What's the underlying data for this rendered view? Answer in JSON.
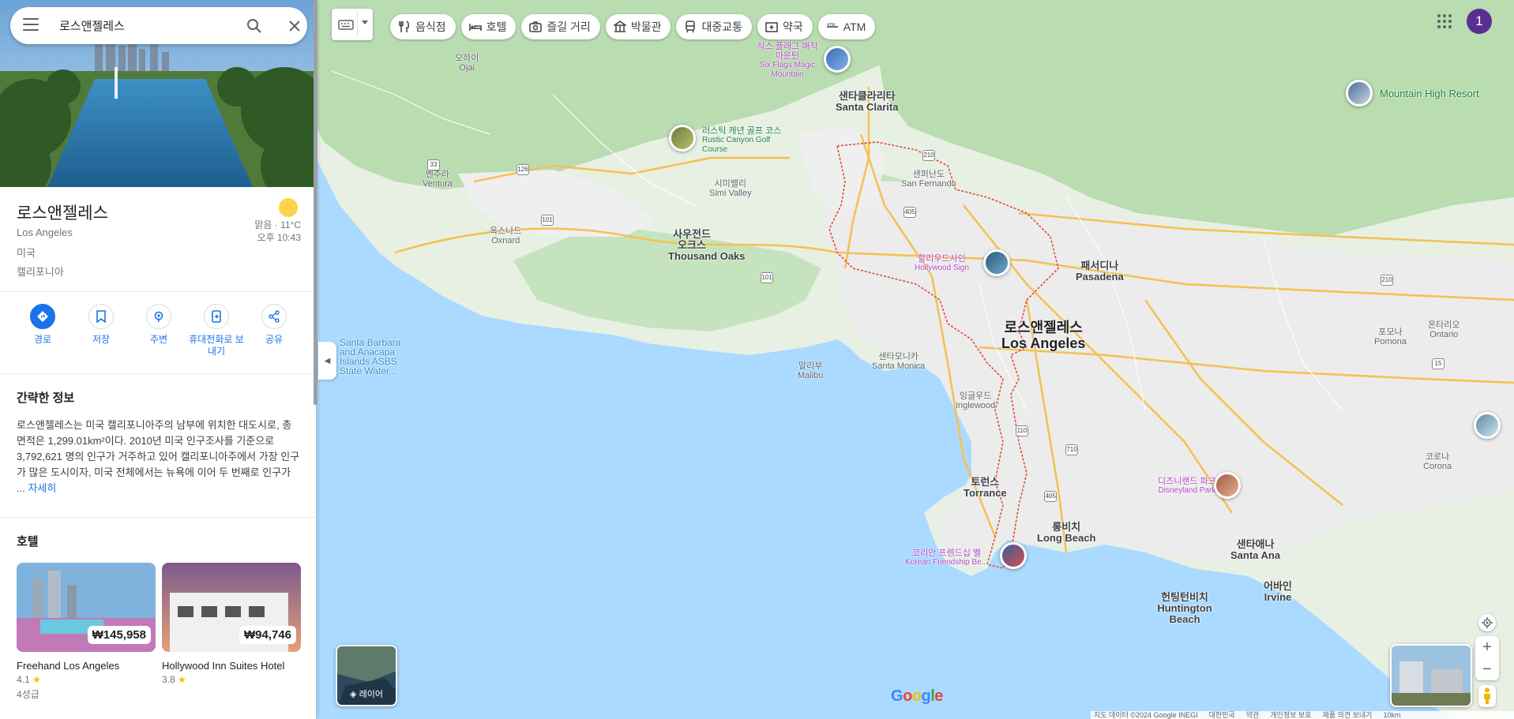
{
  "search": {
    "value": "로스앤젤레스"
  },
  "place": {
    "title": "로스앤젤레스",
    "name_en": "Los Angeles",
    "country": "미국",
    "state": "캘리포니아",
    "weather": "맑음 · 11°C",
    "time": "오후 10:43"
  },
  "actions": [
    {
      "label": "경로",
      "icon": "directions-icon"
    },
    {
      "label": "저장",
      "icon": "bookmark-icon"
    },
    {
      "label": "주변",
      "icon": "nearby-icon"
    },
    {
      "label": "휴대전화로 보내기",
      "icon": "send-to-phone-icon"
    },
    {
      "label": "공유",
      "icon": "share-icon"
    }
  ],
  "about": {
    "heading": "간략한 정보",
    "text": "로스앤젤레스는 미국 캘리포니아주의 남부에 위치한 대도시로, 총면적은 1,299.01km²이다. 2010년 미국 인구조사를 기준으로 3,792,621 명의 인구가 거주하고 있어 캘리포니아주에서 가장 인구가 많은 도시이자, 미국 전체에서는 뉴욕에 이어 두 번째로 인구가 ...",
    "more": "자세히"
  },
  "hotels": {
    "heading": "호텔",
    "items": [
      {
        "price": "₩145,958",
        "name": "Freehand Los Angeles",
        "rating": "4.1",
        "class": "4성급"
      },
      {
        "price": "₩94,746",
        "name": "Hollywood Inn Suites Hotel",
        "rating": "3.8",
        "class": ""
      }
    ]
  },
  "chips": [
    {
      "label": "음식점",
      "icon": "restaurant-icon"
    },
    {
      "label": "호텔",
      "icon": "hotel-icon"
    },
    {
      "label": "즐길 거리",
      "icon": "camera-icon"
    },
    {
      "label": "박물관",
      "icon": "museum-icon"
    },
    {
      "label": "대중교통",
      "icon": "transit-icon"
    },
    {
      "label": "약국",
      "icon": "pharmacy-icon"
    },
    {
      "label": "ATM",
      "icon": "atm-icon"
    }
  ],
  "account": {
    "initial": "1"
  },
  "layers_label": "레이어",
  "footer": [
    "지도 데이터 ©2024 Google INEGI",
    "대한민국",
    "약관",
    "개인정보 보호",
    "제품 의견 보내기",
    "10km"
  ],
  "map_labels": {
    "la_ko": "로스앤젤레스",
    "la_en": "Los Angeles",
    "santa_clarita_ko": "샌타클라리타",
    "santa_clarita_en": "Santa Clarita",
    "pasadena_ko": "패서디나",
    "pasadena_en": "Pasadena",
    "thousand_oaks_ko": "사우전드 오크스",
    "thousand_oaks_en": "Thousand Oaks",
    "torrance_ko": "토런스",
    "torrance_en": "Torrance",
    "long_beach_ko": "롱비치",
    "long_beach_en": "Long Beach",
    "santa_ana_ko": "샌타애나",
    "santa_ana_en": "Santa Ana",
    "irvine_ko": "어바인",
    "irvine_en": "Irvine",
    "huntington_ko": "헌팅턴비치",
    "huntington_en": "Huntington Beach",
    "hollywood_ko": "할리우드사인",
    "hollywood_en": "Hollywood Sign",
    "disney_ko": "디즈니랜드 파크",
    "disney_en": "Disneyland Park",
    "six_flags_ko": "식스 플래그 매직 마운틴",
    "six_flags_en": "Six Flags Magic Mountain",
    "korean_bell_ko": "코리안 프렌드십 벨",
    "korean_bell_en": "Korean Friendship Be...",
    "rustic_ko": "러스틱 캐년 골프 코스",
    "rustic_en": "Rustic Canyon Golf Course",
    "mountain_high": "Mountain High Resort",
    "malibu_ko": "말리부",
    "malibu_en": "Malibu",
    "santa_monica_ko": "샌타모니카",
    "santa_monica_en": "Santa Monica",
    "oxnard_ko": "옥스나드",
    "oxnard_en": "Oxnard",
    "ventura_ko": "벤추라",
    "ventura_en": "Ventura",
    "simi_ko": "시미밸리",
    "simi_en": "Simi Valley",
    "channel_islands": "Santa Barbara and Anacapa Islands ASBS State Water...",
    "ojai_ko": "오하이",
    "ojai_en": "Ojai",
    "san_fernando_ko": "샌퍼난도",
    "san_fernando_en": "San Fernando",
    "inglewood_ko": "잉글우드",
    "inglewood_en": "Inglewood",
    "pomona_ko": "포모나",
    "pomona_en": "Pomona",
    "ontario_ko": "온타리오",
    "ontario_en": "Ontario",
    "corona_ko": "코로나",
    "corona_en": "Corona"
  }
}
